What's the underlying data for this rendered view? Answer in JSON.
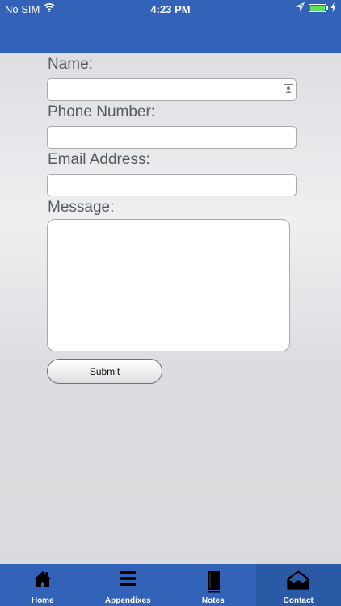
{
  "status_bar": {
    "carrier": "No SIM",
    "time": "4:23 PM",
    "battery_color": "#5ee25b"
  },
  "theme": {
    "header_color": "#3263b8",
    "tabbar_color": "#3263b8"
  },
  "form": {
    "name_label": "Name:",
    "name_value": "",
    "phone_label": "Phone Number:",
    "phone_value": "",
    "email_label": "Email Address:",
    "email_value": "",
    "message_label": "Message:",
    "message_value": "",
    "submit_label": "Submit"
  },
  "tabs": [
    {
      "label": "Home",
      "icon": "home-icon",
      "active": false
    },
    {
      "label": "Appendixes",
      "icon": "list-icon",
      "active": false
    },
    {
      "label": "Notes",
      "icon": "book-icon",
      "active": false
    },
    {
      "label": "Contact",
      "icon": "envelope-icon",
      "active": true
    }
  ]
}
